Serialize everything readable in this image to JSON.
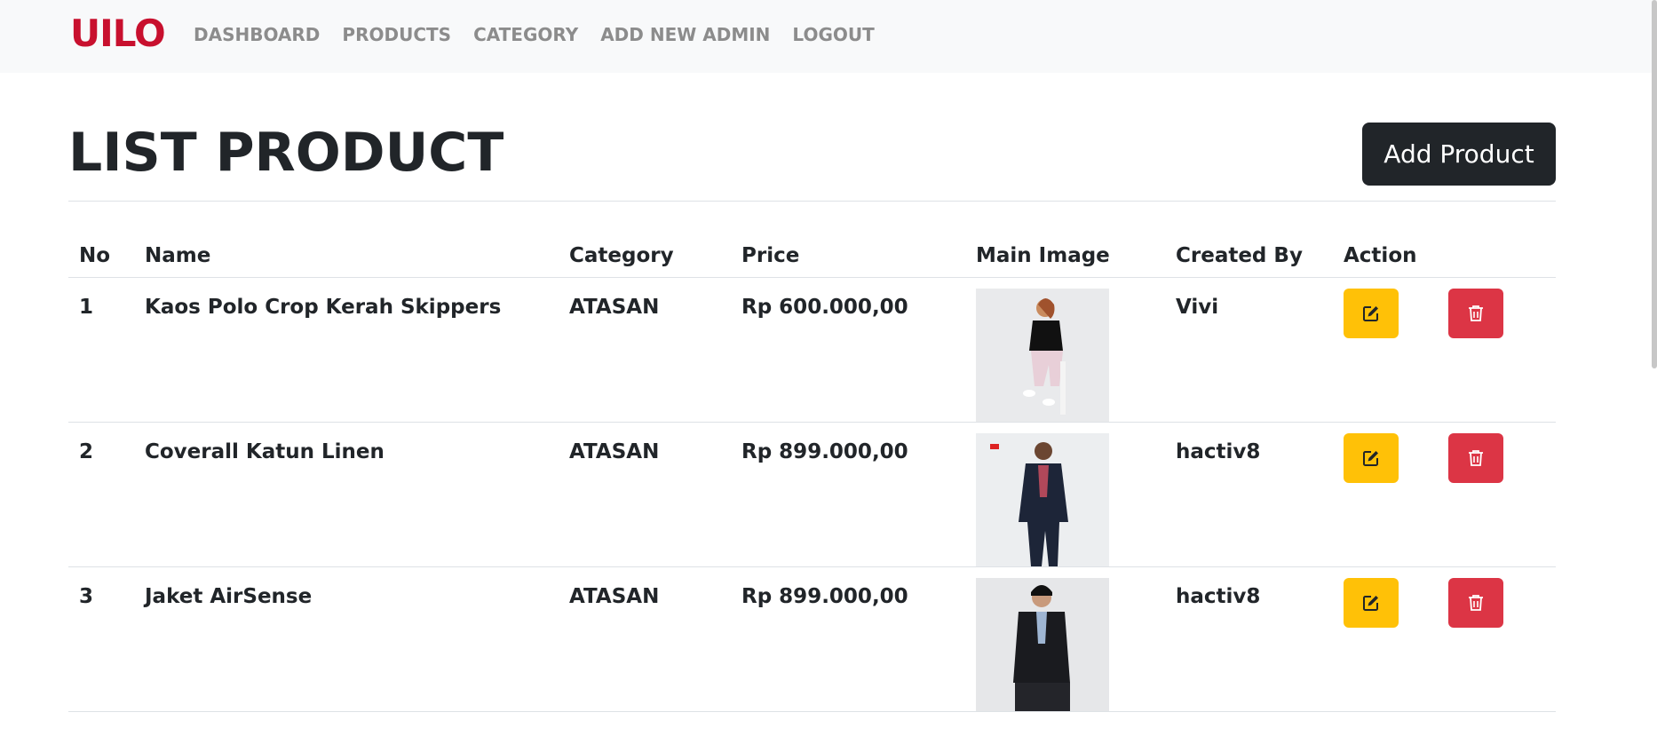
{
  "navbar": {
    "brand": "UILO",
    "links": [
      "DASHBOARD",
      "PRODUCTS",
      "CATEGORY",
      "ADD NEW ADMIN",
      "LOGOUT"
    ]
  },
  "page": {
    "title": "LIST PRODUCT",
    "add_button": "Add Product"
  },
  "table": {
    "headers": [
      "No",
      "Name",
      "Category",
      "Price",
      "Main Image",
      "Created By",
      "Action"
    ],
    "rows": [
      {
        "no": "1",
        "name": "Kaos Polo Crop Kerah Skippers",
        "category": "ATASAN",
        "price": "Rp 600.000,00",
        "image_alt": "woman in black polo shirt",
        "created_by": "Vivi"
      },
      {
        "no": "2",
        "name": "Coverall Katun Linen",
        "category": "ATASAN",
        "price": "Rp 899.000,00",
        "image_alt": "woman in navy linen coverall",
        "created_by": "hactiv8"
      },
      {
        "no": "3",
        "name": "Jaket AirSense",
        "category": "ATASAN",
        "price": "Rp 899.000,00",
        "image_alt": "man in dark jacket",
        "created_by": "hactiv8"
      }
    ]
  },
  "icons": {
    "edit": "pencil-square-icon",
    "delete": "trash-icon"
  },
  "colors": {
    "brand": "#c8102e",
    "edit_button": "#ffc107",
    "delete_button": "#dc3545",
    "primary_dark": "#212529"
  }
}
